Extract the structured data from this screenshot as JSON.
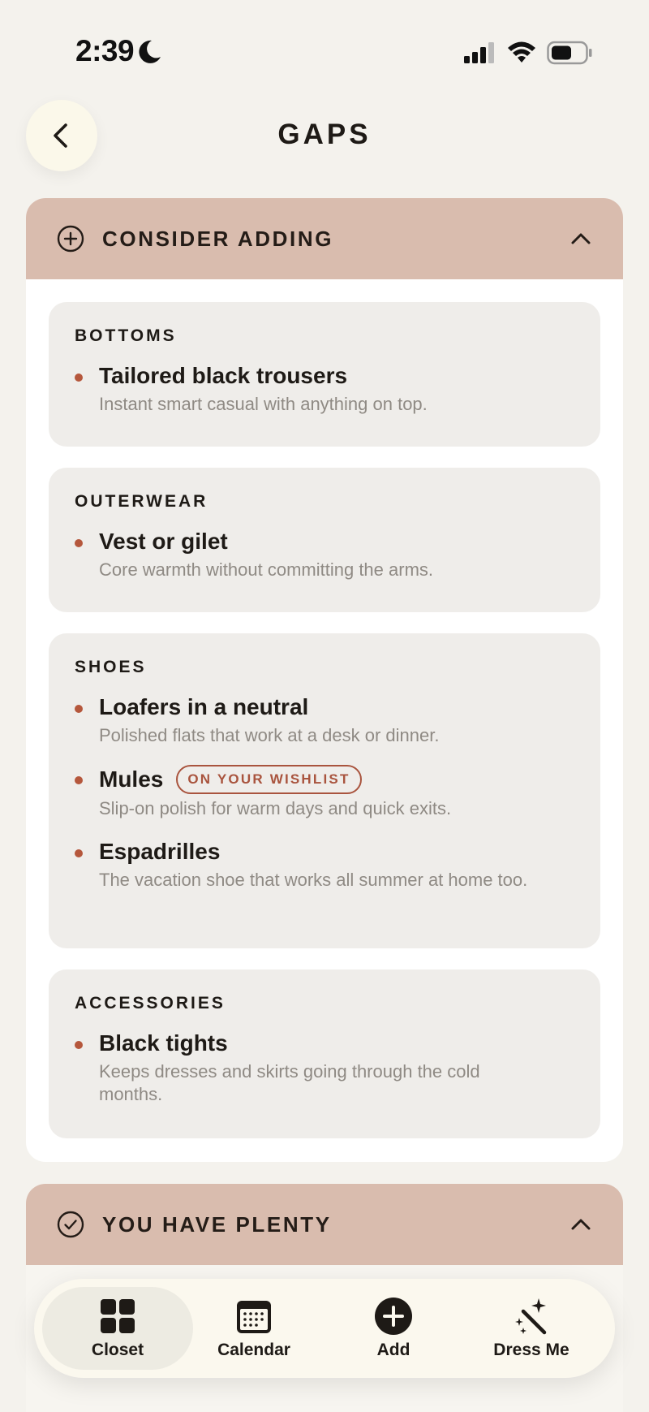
{
  "status_bar": {
    "time": "2:39"
  },
  "header": {
    "title": "GAPS"
  },
  "consider_section": {
    "title": "CONSIDER ADDING",
    "groups": [
      {
        "title": "BOTTOMS",
        "items": [
          {
            "title": "Tailored black trousers",
            "desc": "Instant smart casual with anything on top."
          }
        ]
      },
      {
        "title": "OUTERWEAR",
        "items": [
          {
            "title": "Vest or gilet",
            "desc": "Core warmth without committing the arms."
          }
        ]
      },
      {
        "title": "SHOES",
        "items": [
          {
            "title": "Loafers in a neutral",
            "desc": "Polished flats that work at a desk or dinner."
          },
          {
            "title": "Mules",
            "badge": "ON YOUR WISHLIST",
            "desc": "Slip-on polish for warm days and quick exits."
          },
          {
            "title": "Espadrilles",
            "desc": "The vacation shoe that works all summer at home too."
          }
        ]
      },
      {
        "title": "ACCESSORIES",
        "items": [
          {
            "title": "Black tights",
            "desc": "Keeps dresses and skirts going through the cold months."
          }
        ]
      }
    ]
  },
  "plenty_section": {
    "title": "YOU HAVE PLENTY"
  },
  "tab_bar": {
    "tabs": [
      {
        "label": "Closet",
        "icon": "grid-icon",
        "active": true
      },
      {
        "label": "Calendar",
        "icon": "calendar-icon"
      },
      {
        "label": "Add",
        "icon": "plus-circle-icon"
      },
      {
        "label": "Dress Me",
        "icon": "magic-wand-icon"
      }
    ]
  },
  "colors": {
    "background": "#f4f2ed",
    "section_header": "#d9bcae",
    "group_card": "#efedea",
    "accent": "#b5573c",
    "muted_text": "#8f8a84"
  }
}
